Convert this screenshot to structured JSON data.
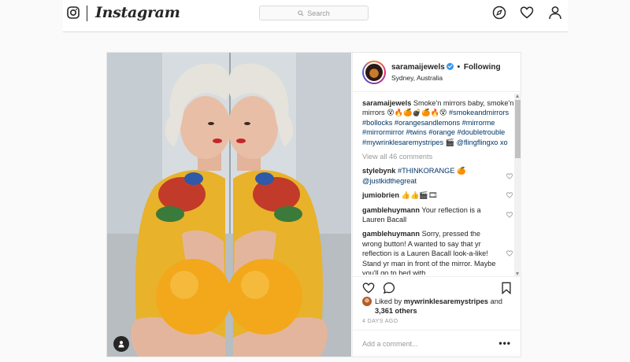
{
  "header": {
    "logo_icon": "instagram-camera-icon",
    "wordmark": "Instagram",
    "search_placeholder": "Search",
    "nav_icons": [
      "compass-icon",
      "heart-icon",
      "person-icon"
    ]
  },
  "post": {
    "username": "saramaijewels",
    "verified": true,
    "separator": "•",
    "following_label": "Following",
    "location": "Sydney, Australia",
    "caption": {
      "username": "saramaijewels",
      "text": "Smoke'n mirrors baby, smoke'n mirrors 😵🔥🍊💣🍊🔥😵",
      "hashtags": "#smokeandmirrors #bollocks #orangesandlemons #mirrorme #mirrormirror #twins #orange #doubletrouble #mywrinklesaremystripes 🎬 @flingflingxo xo"
    },
    "view_all_comments": "View all 46 comments",
    "comments": [
      {
        "username": "stylebynk",
        "text": "#THINKORANGE 🍊",
        "mention": "@justkidthegreat"
      },
      {
        "username": "jumiobrien",
        "text": "👍👍🎬🎞"
      },
      {
        "username": "gamblehuymann",
        "text": "Your reflection is a Lauren Bacall"
      },
      {
        "username": "gamblehuymann",
        "text": "Sorry, pressed the wrong button! A wanted to say that yr reflection is a Lauren Bacall look-a-like! Stand yr man in front of the mirror. Maybe you'll go to bed with"
      }
    ],
    "likes": {
      "prefix": "Liked by",
      "first_liker": "mywrinklesaremystripes",
      "conjunction": "and",
      "others": "3,361 others"
    },
    "time_ago": "4 DAYS AGO",
    "add_comment_placeholder": "Add a comment...",
    "more_options": "•••",
    "colors": {
      "link": "#003569",
      "muted": "#999999",
      "verified": "#3897f0",
      "border": "#dbdbdb"
    }
  }
}
